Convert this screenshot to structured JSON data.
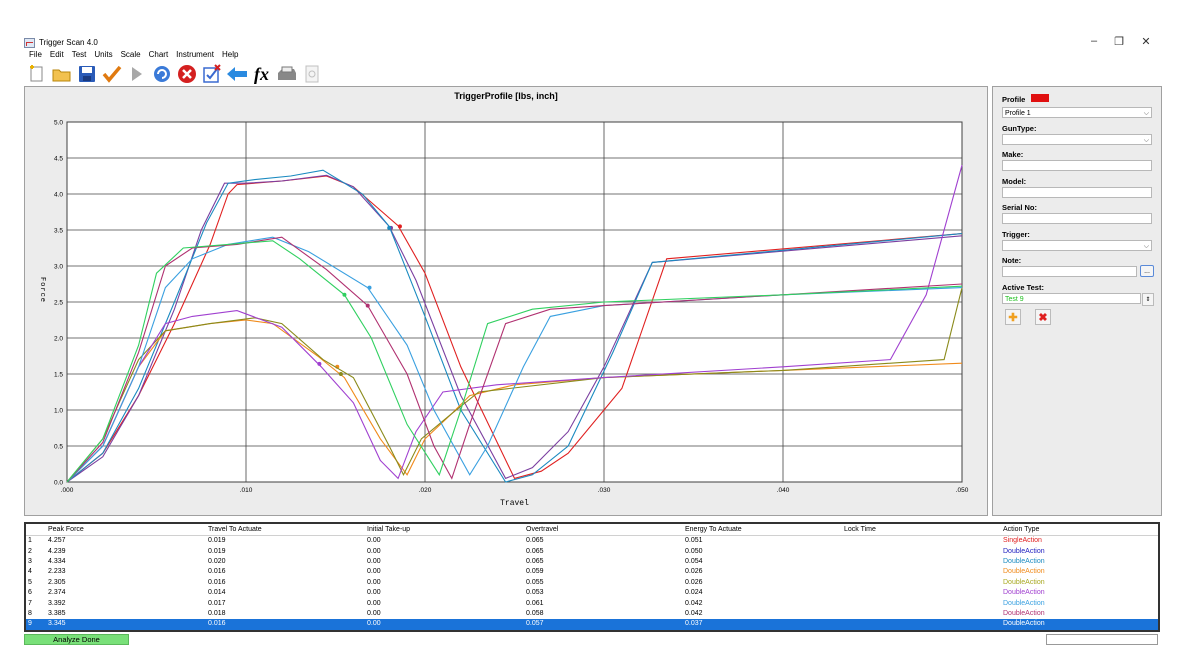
{
  "window": {
    "title": "Trigger Scan 4.0",
    "controls": [
      "–",
      "❐",
      "✕"
    ]
  },
  "menu": [
    "File",
    "Edit",
    "Test",
    "Units",
    "Scale",
    "Chart",
    "Instrument",
    "Help"
  ],
  "toolbar": [
    "new-icon",
    "open-folder-icon",
    "save-icon",
    "check-icon",
    "play-icon",
    "refresh-icon",
    "stop-icon",
    "checkbox-icon",
    "back-arrow-icon",
    "fx-icon",
    "print-icon",
    "print-preview-icon"
  ],
  "chart_data": {
    "type": "line",
    "title": "TriggerProfile [lbs, inch]",
    "xlabel": "Travel",
    "ylabel": "Force",
    "xlim": [
      0,
      0.05
    ],
    "ylim": [
      0,
      5
    ],
    "x_ticks": [
      ".000",
      ".010",
      ".020",
      ".030",
      ".040",
      ".050"
    ],
    "y_ticks": [
      "0.0",
      "0.5",
      "1.0",
      "1.5",
      "2.0",
      "2.5",
      "3.0",
      "3.5",
      "4.0",
      "4.5",
      "5.0"
    ],
    "grid": true,
    "series": [
      {
        "color": "#e02020",
        "points": [
          [
            0,
            0
          ],
          [
            0.002,
            0.4
          ],
          [
            0.004,
            1.2
          ],
          [
            0.006,
            2.2
          ],
          [
            0.008,
            3.3
          ],
          [
            0.009,
            4.0
          ],
          [
            0.0095,
            4.13
          ],
          [
            0.012,
            4.18
          ],
          [
            0.0145,
            4.25
          ],
          [
            0.016,
            4.1
          ],
          [
            0.0185,
            3.56
          ],
          [
            0.02,
            2.9
          ],
          [
            0.022,
            1.6
          ],
          [
            0.025,
            0.05
          ],
          [
            0.0265,
            0.15
          ],
          [
            0.028,
            0.4
          ],
          [
            0.031,
            1.3
          ],
          [
            0.0335,
            3.1
          ],
          [
            0.05,
            3.45
          ]
        ],
        "marker": [
          0.0186,
          3.55
        ]
      },
      {
        "color": "#7b3fa0",
        "points": [
          [
            0,
            0
          ],
          [
            0.002,
            0.35
          ],
          [
            0.004,
            1.2
          ],
          [
            0.006,
            2.4
          ],
          [
            0.0075,
            3.5
          ],
          [
            0.0088,
            4.15
          ],
          [
            0.01,
            4.15
          ],
          [
            0.012,
            4.18
          ],
          [
            0.0145,
            4.26
          ],
          [
            0.016,
            4.1
          ],
          [
            0.018,
            3.55
          ],
          [
            0.0195,
            2.8
          ],
          [
            0.022,
            1.2
          ],
          [
            0.0245,
            0.05
          ],
          [
            0.026,
            0.2
          ],
          [
            0.028,
            0.7
          ],
          [
            0.03,
            1.6
          ],
          [
            0.0327,
            3.05
          ],
          [
            0.05,
            3.42
          ]
        ],
        "marker": [
          0.0181,
          3.53
        ]
      },
      {
        "color": "#1a8ac0",
        "points": [
          [
            0,
            0
          ],
          [
            0.002,
            0.4
          ],
          [
            0.004,
            1.3
          ],
          [
            0.006,
            2.5
          ],
          [
            0.0078,
            3.6
          ],
          [
            0.009,
            4.15
          ],
          [
            0.0105,
            4.2
          ],
          [
            0.0125,
            4.25
          ],
          [
            0.0143,
            4.33
          ],
          [
            0.0165,
            4.0
          ],
          [
            0.018,
            3.55
          ],
          [
            0.02,
            2.3
          ],
          [
            0.022,
            1.0
          ],
          [
            0.0245,
            0.0
          ],
          [
            0.026,
            0.1
          ],
          [
            0.028,
            0.5
          ],
          [
            0.0305,
            1.8
          ],
          [
            0.0327,
            3.05
          ],
          [
            0.05,
            3.45
          ]
        ],
        "marker": [
          0.018,
          3.53
        ]
      },
      {
        "color": "#f08a1a",
        "points": [
          [
            0,
            0
          ],
          [
            0.002,
            0.5
          ],
          [
            0.004,
            1.6
          ],
          [
            0.0055,
            2.1
          ],
          [
            0.008,
            2.2
          ],
          [
            0.01,
            2.25
          ],
          [
            0.0115,
            2.2
          ],
          [
            0.014,
            1.75
          ],
          [
            0.0155,
            1.45
          ],
          [
            0.0175,
            0.6
          ],
          [
            0.019,
            0.1
          ],
          [
            0.02,
            0.6
          ],
          [
            0.0215,
            0.95
          ],
          [
            0.0225,
            1.2
          ],
          [
            0.025,
            1.35
          ],
          [
            0.03,
            1.45
          ],
          [
            0.04,
            1.55
          ],
          [
            0.05,
            1.65
          ]
        ],
        "marker": [
          0.0151,
          1.6
        ]
      },
      {
        "color": "#8a8a1a",
        "points": [
          [
            0,
            0
          ],
          [
            0.002,
            0.6
          ],
          [
            0.004,
            1.7
          ],
          [
            0.0055,
            2.1
          ],
          [
            0.008,
            2.2
          ],
          [
            0.0105,
            2.28
          ],
          [
            0.012,
            2.2
          ],
          [
            0.0143,
            1.7
          ],
          [
            0.016,
            1.45
          ],
          [
            0.018,
            0.5
          ],
          [
            0.0188,
            0.1
          ],
          [
            0.0198,
            0.6
          ],
          [
            0.0215,
            0.95
          ],
          [
            0.023,
            1.25
          ],
          [
            0.03,
            1.45
          ],
          [
            0.04,
            1.55
          ],
          [
            0.049,
            1.7
          ],
          [
            0.05,
            2.7
          ]
        ],
        "marker": [
          0.0153,
          1.5
        ]
      },
      {
        "color": "#a040d0",
        "points": [
          [
            0,
            0
          ],
          [
            0.002,
            0.5
          ],
          [
            0.004,
            1.6
          ],
          [
            0.0055,
            2.2
          ],
          [
            0.007,
            2.3
          ],
          [
            0.0095,
            2.38
          ],
          [
            0.012,
            2.15
          ],
          [
            0.0142,
            1.6
          ],
          [
            0.016,
            1.1
          ],
          [
            0.0175,
            0.3
          ],
          [
            0.0185,
            0.05
          ],
          [
            0.0195,
            0.7
          ],
          [
            0.021,
            1.25
          ],
          [
            0.024,
            1.35
          ],
          [
            0.03,
            1.45
          ],
          [
            0.04,
            1.6
          ],
          [
            0.046,
            1.7
          ],
          [
            0.048,
            2.6
          ],
          [
            0.05,
            4.4
          ]
        ],
        "marker": [
          0.0141,
          1.64
        ]
      },
      {
        "color": "#3aa0e0",
        "points": [
          [
            0,
            0
          ],
          [
            0.002,
            0.5
          ],
          [
            0.004,
            1.6
          ],
          [
            0.0055,
            2.7
          ],
          [
            0.007,
            3.1
          ],
          [
            0.009,
            3.3
          ],
          [
            0.0115,
            3.4
          ],
          [
            0.0135,
            3.2
          ],
          [
            0.0168,
            2.7
          ],
          [
            0.019,
            1.9
          ],
          [
            0.0205,
            1.0
          ],
          [
            0.0225,
            0.1
          ],
          [
            0.0235,
            0.5
          ],
          [
            0.0255,
            1.6
          ],
          [
            0.027,
            2.3
          ],
          [
            0.03,
            2.45
          ],
          [
            0.04,
            2.6
          ],
          [
            0.05,
            2.7
          ]
        ],
        "marker": [
          0.0169,
          2.7
        ]
      },
      {
        "color": "#b03070",
        "points": [
          [
            0,
            0
          ],
          [
            0.002,
            0.55
          ],
          [
            0.004,
            1.8
          ],
          [
            0.0055,
            3.0
          ],
          [
            0.007,
            3.25
          ],
          [
            0.0095,
            3.3
          ],
          [
            0.012,
            3.4
          ],
          [
            0.0145,
            2.95
          ],
          [
            0.0168,
            2.45
          ],
          [
            0.019,
            1.5
          ],
          [
            0.0205,
            0.5
          ],
          [
            0.0215,
            0.05
          ],
          [
            0.0225,
            0.8
          ],
          [
            0.0245,
            2.2
          ],
          [
            0.027,
            2.4
          ],
          [
            0.03,
            2.45
          ],
          [
            0.04,
            2.6
          ],
          [
            0.05,
            2.75
          ]
        ],
        "marker": [
          0.0168,
          2.45
        ]
      },
      {
        "color": "#30d060",
        "points": [
          [
            0,
            0
          ],
          [
            0.002,
            0.6
          ],
          [
            0.004,
            1.9
          ],
          [
            0.005,
            2.9
          ],
          [
            0.0065,
            3.25
          ],
          [
            0.009,
            3.3
          ],
          [
            0.0115,
            3.35
          ],
          [
            0.013,
            3.1
          ],
          [
            0.0155,
            2.6
          ],
          [
            0.017,
            2.0
          ],
          [
            0.019,
            0.8
          ],
          [
            0.0208,
            0.1
          ],
          [
            0.022,
            1.0
          ],
          [
            0.0235,
            2.2
          ],
          [
            0.026,
            2.4
          ],
          [
            0.03,
            2.5
          ],
          [
            0.04,
            2.6
          ],
          [
            0.05,
            2.72
          ]
        ],
        "marker": [
          0.0155,
          2.6
        ]
      }
    ]
  },
  "side": {
    "profile_label": "Profile",
    "profile_value": "Profile 1",
    "guntype_label": "GunType:",
    "guntype_value": "",
    "make_label": "Make:",
    "model_label": "Model:",
    "serial_label": "Serial No:",
    "trigger_label": "Trigger:",
    "note_label": "Note:",
    "note_button": "...",
    "active_label": "Active Test:",
    "active_value": "Test 9",
    "add_icon": "plus-icon",
    "delete_icon": "delete-x-icon",
    "colors": {
      "profile_swatch": "#e01010",
      "active_text": "#20c020"
    }
  },
  "table": {
    "headers": [
      "",
      "Peak Force",
      "Travel To Actuate",
      "Initial Take-up",
      "Overtravel",
      "Energy To Actuate",
      "Lock Time",
      "Action Type"
    ],
    "rows": [
      {
        "n": "1",
        "peak": "4.257",
        "travel": "0.019",
        "takeup": "0.00",
        "over": "0.065",
        "energy": "0.051",
        "lock": "",
        "action": "SingleAction",
        "color": "#e02020"
      },
      {
        "n": "2",
        "peak": "4.239",
        "travel": "0.019",
        "takeup": "0.00",
        "over": "0.065",
        "energy": "0.050",
        "lock": "",
        "action": "DoubleAction",
        "color": "#2020c0"
      },
      {
        "n": "3",
        "peak": "4.334",
        "travel": "0.020",
        "takeup": "0.00",
        "over": "0.065",
        "energy": "0.054",
        "lock": "",
        "action": "DoubleAction",
        "color": "#1a8ac0"
      },
      {
        "n": "4",
        "peak": "2.233",
        "travel": "0.016",
        "takeup": "0.00",
        "over": "0.059",
        "energy": "0.026",
        "lock": "",
        "action": "DoubleAction",
        "color": "#f08a1a"
      },
      {
        "n": "5",
        "peak": "2.305",
        "travel": "0.016",
        "takeup": "0.00",
        "over": "0.055",
        "energy": "0.026",
        "lock": "",
        "action": "DoubleAction",
        "color": "#a8a820"
      },
      {
        "n": "6",
        "peak": "2.374",
        "travel": "0.014",
        "takeup": "0.00",
        "over": "0.053",
        "energy": "0.024",
        "lock": "",
        "action": "DoubleAction",
        "color": "#a040d0"
      },
      {
        "n": "7",
        "peak": "3.392",
        "travel": "0.017",
        "takeup": "0.00",
        "over": "0.061",
        "energy": "0.042",
        "lock": "",
        "action": "DoubleAction",
        "color": "#3aa0e0"
      },
      {
        "n": "8",
        "peak": "3.385",
        "travel": "0.018",
        "takeup": "0.00",
        "over": "0.058",
        "energy": "0.042",
        "lock": "",
        "action": "DoubleAction",
        "color": "#b03070"
      },
      {
        "n": "9",
        "peak": "3.345",
        "travel": "0.016",
        "takeup": "0.00",
        "over": "0.057",
        "energy": "0.037",
        "lock": "",
        "action": "DoubleAction",
        "color": "#ffffff",
        "selected": true
      }
    ]
  },
  "status": {
    "left": "Analyze Done"
  }
}
